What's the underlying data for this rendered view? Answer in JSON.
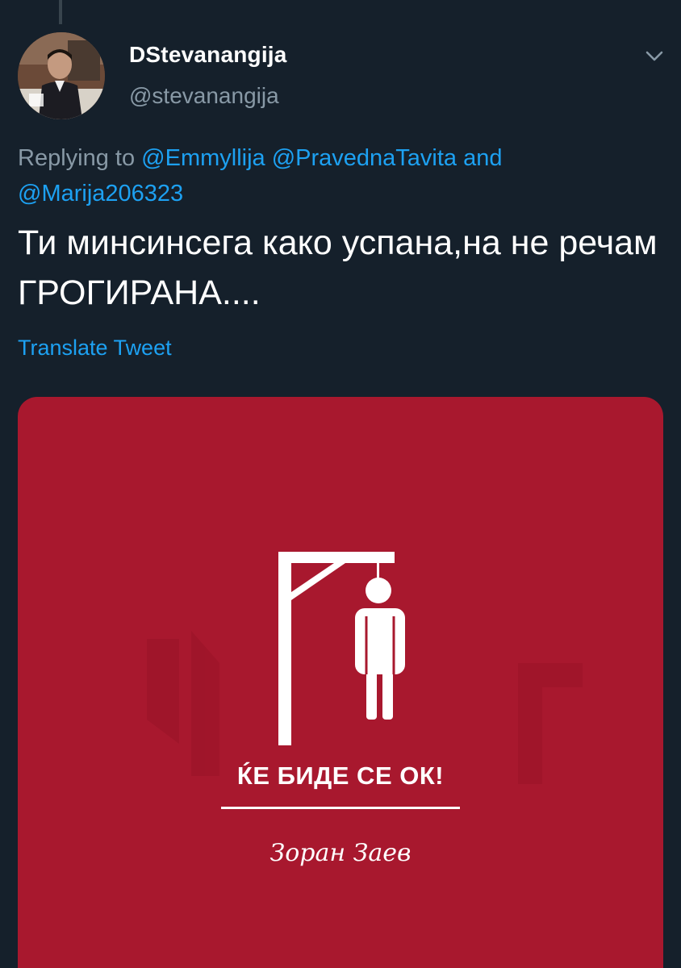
{
  "tweet": {
    "display_name": "DStevanangija",
    "handle": "@stevanangija",
    "replying_prefix": "Replying to",
    "mentions": [
      "@Emmyllija",
      "@PravednaTavita",
      "@Marija206323"
    ],
    "conjunction": "and",
    "text": "Ти минсинсега како успана,на не речам ГРОГИРАНА....",
    "translate_label": "Translate Tweet",
    "media": {
      "slogan": "ЌЕ БИДЕ СЕ ОК!",
      "signature": "Зоран Заев",
      "background_color": "#a8182e"
    }
  },
  "icons": {
    "more": "chevron-down-icon",
    "avatar": "profile-avatar"
  },
  "colors": {
    "background": "#15202b",
    "link": "#1da1f2",
    "secondary_text": "#8899a6",
    "primary_text": "#ffffff"
  }
}
